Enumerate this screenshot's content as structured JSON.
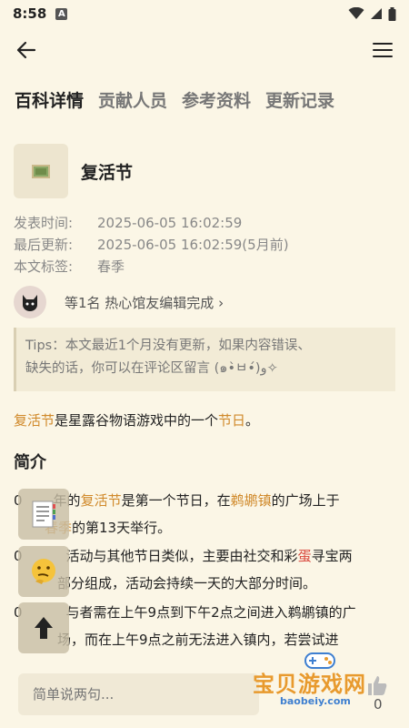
{
  "status": {
    "time": "8:58",
    "a_icon": "A"
  },
  "nav": {
    "back_icon": "arrow-left-icon",
    "menu_icon": "hamburger-menu-icon"
  },
  "tabs": [
    {
      "label": "百科详情",
      "active": true
    },
    {
      "label": "贡献人员",
      "active": false
    },
    {
      "label": "参考资料",
      "active": false
    },
    {
      "label": "更新记录",
      "active": false
    }
  ],
  "entry": {
    "title": "复活节"
  },
  "meta": {
    "published_label": "发表时间:",
    "published_value": "2025-06-05 16:02:59",
    "updated_label": "最后更新:",
    "updated_value": "2025-06-05 16:02:59(5月前)",
    "tags_label": "本文标签:",
    "tags_value": "春季"
  },
  "contrib": {
    "text": "等1名 热心馆友编辑完成",
    "chevron": "›"
  },
  "tips": {
    "line1": "Tips：本文最近1个月没有更新，如果内容错误、",
    "line2": "缺失的话，你可以在评论区留言 (๑•̀ㅂ•́)و✧"
  },
  "intro": {
    "link1": "复活节",
    "mid": "是星露谷物语游戏中的一个",
    "link2": "节日",
    "end": "。"
  },
  "section": {
    "heading": "简介"
  },
  "para1": {
    "prefix": "0",
    "a": "年的",
    "link1": "复活节",
    "b": "是第一个节日，在",
    "link2": "鹈鹕镇",
    "c": "的广场上于",
    "link3": "春季",
    "d": "的第13天举行。"
  },
  "para2": {
    "prefix": "0",
    "a": "活动与其他节日类似，主要由社交和彩",
    "red": "蛋",
    "b": "寻宝两",
    "c": "部分组成，活动会持续一天的大部分时间。"
  },
  "para3": {
    "prefix": "0",
    "a": "与者需在上午9点到下午2点之间进入鹈鹕镇的广",
    "b": "场，而在上午9点之前无法进入镇内，若尝试进"
  },
  "fabs": [
    "document-icon",
    "thinking-face-icon",
    "arrow-up-icon"
  ],
  "comment": {
    "placeholder": "简单说两句..."
  },
  "like": {
    "count": "0"
  },
  "watermark": {
    "text": "宝贝游戏网",
    "domain": "baobeiy.com"
  },
  "colors": {
    "background": "#FBF6E6",
    "link": "#D0892A",
    "highlight": "#D9453A"
  }
}
